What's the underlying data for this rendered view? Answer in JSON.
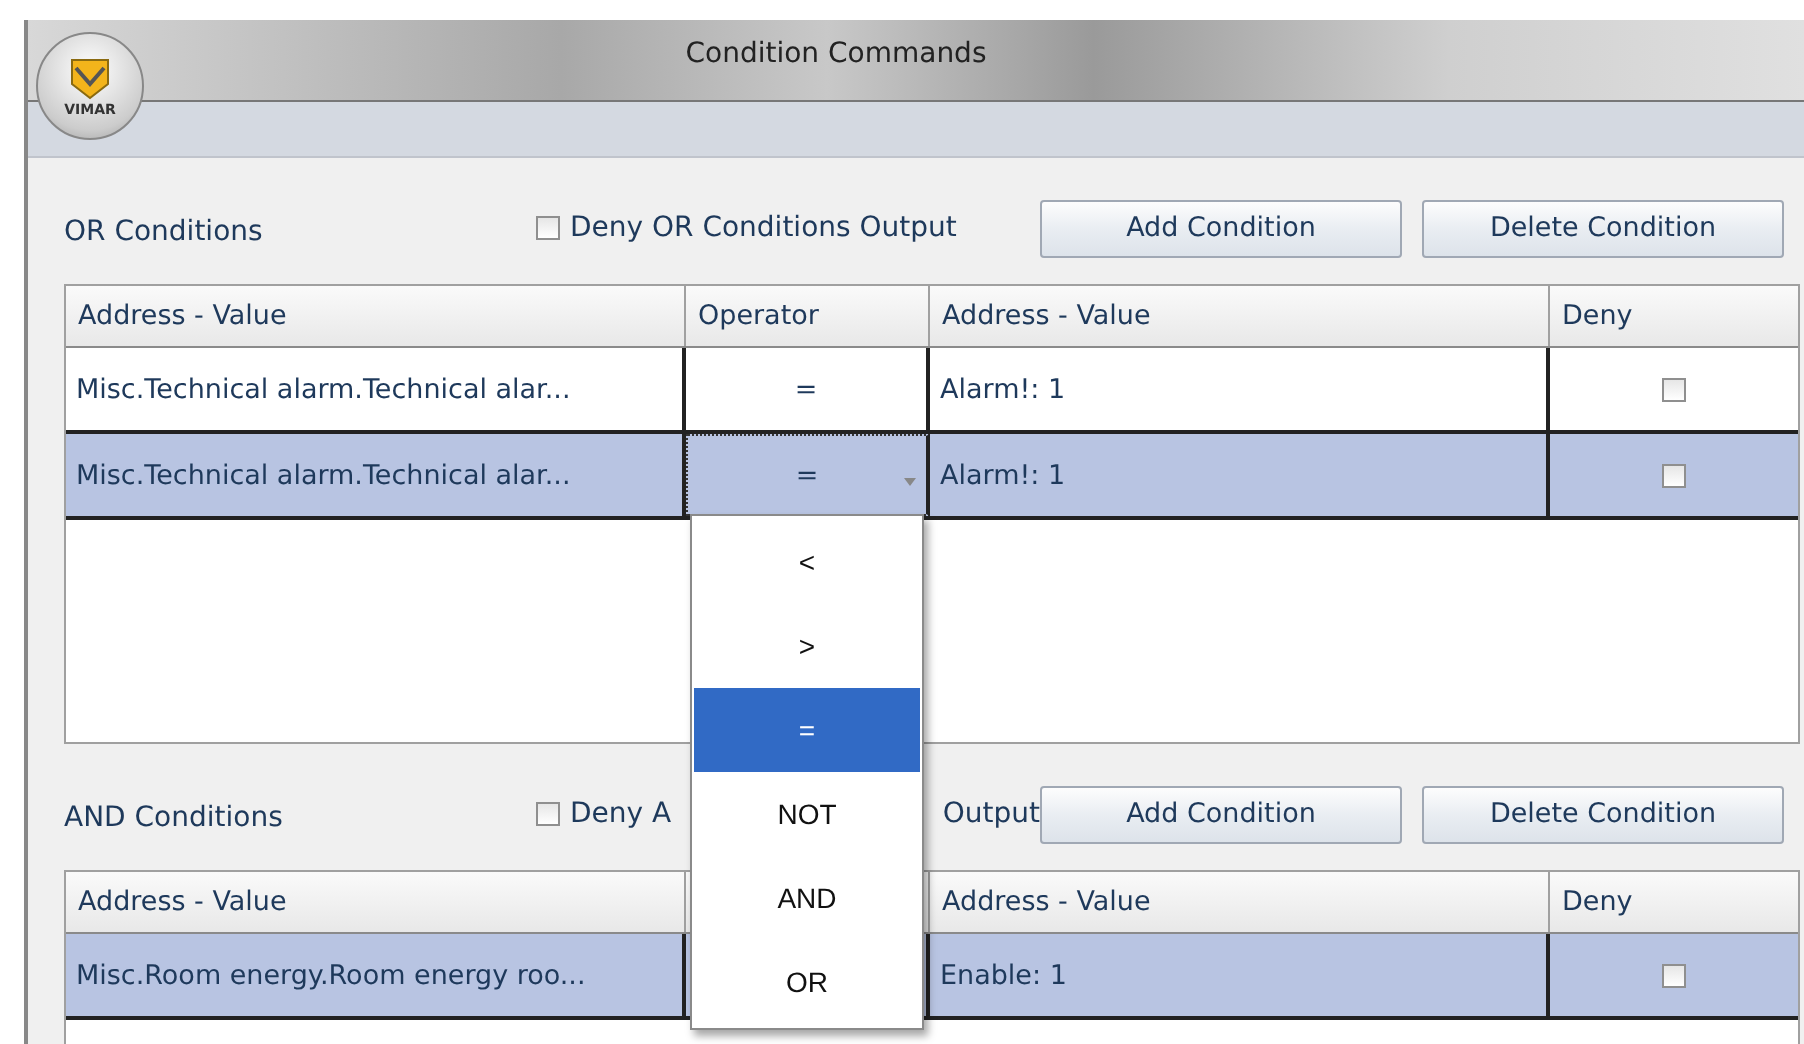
{
  "window": {
    "title": "Condition Commands",
    "logo_text": "VIMAR"
  },
  "or_conditions": {
    "title": "OR Conditions",
    "deny_output": {
      "label_parts": [
        "Deny OR Conditions Output"
      ],
      "checked": false
    },
    "buttons": [
      "Add Condition",
      "Delete Condition"
    ],
    "columns": [
      {
        "kind": "address",
        "label": "Address - Value"
      },
      {
        "kind": "operator",
        "label": "Operator"
      },
      {
        "kind": "value",
        "label": "Address - Value"
      },
      {
        "kind": "deny",
        "label": "Deny"
      }
    ],
    "rows": [
      {
        "address": "Misc.Technical alarm.Technical alar...",
        "operator": "=",
        "value": "Alarm!: 1",
        "deny": false,
        "selected": false,
        "editing": false
      },
      {
        "address": "Misc.Technical alarm.Technical alar...",
        "operator": "=",
        "value": "Alarm!: 1",
        "deny": false,
        "selected": true,
        "editing": true
      }
    ]
  },
  "and_conditions": {
    "title": "AND Conditions",
    "deny_output": {
      "label_parts": [
        "Deny A",
        "Output"
      ],
      "checked": false
    },
    "buttons": [
      "Add Condition",
      "Delete Condition"
    ],
    "columns": [
      {
        "kind": "address",
        "label": "Address - Value"
      },
      {
        "kind": "operator"
      },
      {
        "kind": "value",
        "label": "Address - Value"
      },
      {
        "kind": "deny",
        "label": "Deny"
      }
    ],
    "rows": [
      {
        "address": "Misc.Room energy.Room energy roo...",
        "value": "Enable: 1",
        "deny": false,
        "selected": true,
        "editing": false
      }
    ]
  },
  "operator_dropdown": {
    "items": [
      {
        "label": "<",
        "selected": false
      },
      {
        "label": ">",
        "selected": false
      },
      {
        "label": "=",
        "selected": true
      },
      {
        "label": "NOT",
        "selected": false
      },
      {
        "label": "AND",
        "selected": false
      },
      {
        "label": "OR",
        "selected": false
      }
    ]
  }
}
